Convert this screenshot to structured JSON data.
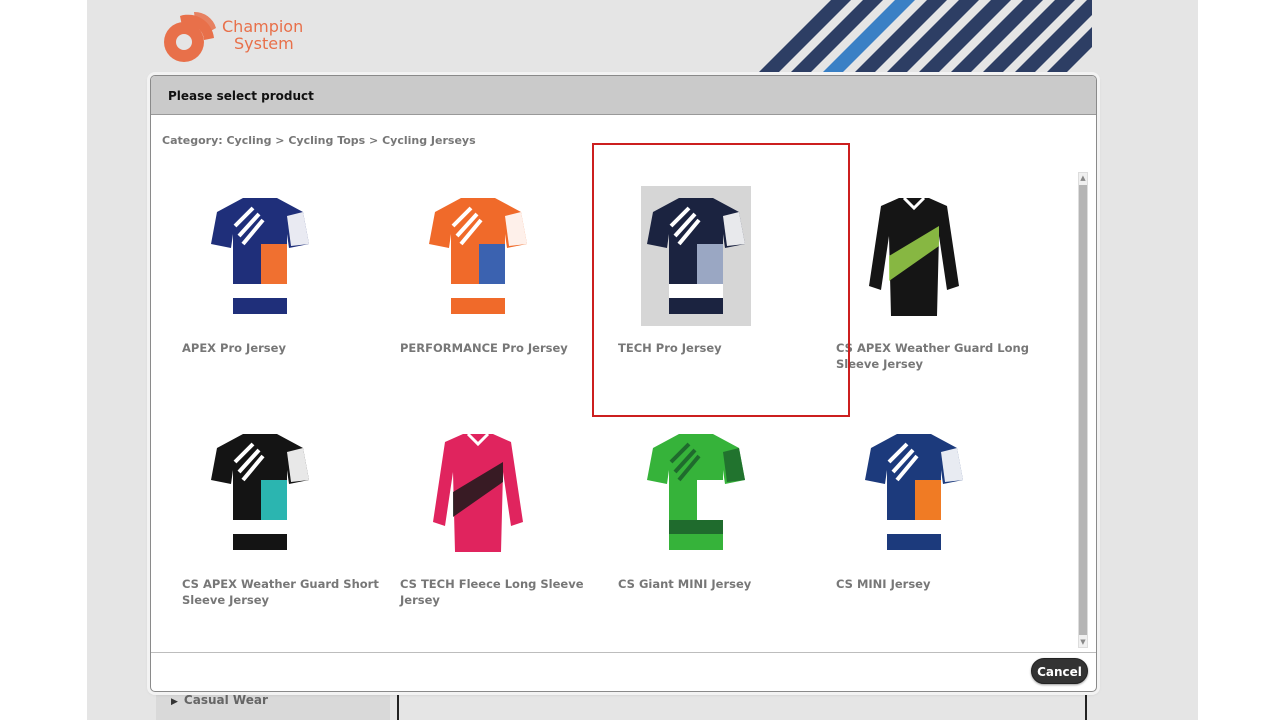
{
  "brand": {
    "line1": "Champion",
    "line2": "System",
    "color": "#e8704a"
  },
  "sidebar": {
    "visible_item": "Casual Wear"
  },
  "dialog": {
    "title": "Please select product",
    "breadcrumb": "Category: Cycling > Cycling Tops > Cycling Jerseys",
    "cancel_label": "Cancel",
    "products": [
      {
        "name": "APEX Pro Jersey",
        "icon": "short-sleeve-jersey-icon",
        "colors": [
          "#1f2f7a",
          "#f07030",
          "#ffffff"
        ]
      },
      {
        "name": "PERFORMANCE Pro Jersey",
        "icon": "short-sleeve-jersey-icon",
        "colors": [
          "#f06a2a",
          "#3b62b0",
          "#ffffff"
        ]
      },
      {
        "name": "TECH Pro Jersey",
        "icon": "short-sleeve-jersey-icon",
        "colors": [
          "#1b2340",
          "#9aa7c3",
          "#ffffff"
        ]
      },
      {
        "name": "CS APEX Weather Guard Long Sleeve Jersey",
        "icon": "long-sleeve-jersey-icon",
        "colors": [
          "#151515",
          "#9bd34a",
          "#ffffff"
        ]
      },
      {
        "name": "CS APEX Weather Guard Short Sleeve Jersey",
        "icon": "short-sleeve-jersey-icon",
        "colors": [
          "#141414",
          "#2bb5b0",
          "#ffffff"
        ]
      },
      {
        "name": "CS TECH Fleece Long Sleeve Jersey",
        "icon": "long-sleeve-jersey-icon",
        "colors": [
          "#e0245e",
          "#1a1a1a",
          "#ffffff"
        ]
      },
      {
        "name": "CS Giant MINI Jersey",
        "icon": "short-sleeve-jersey-icon",
        "colors": [
          "#36b33a",
          "#ffffff",
          "#1f6b2d"
        ]
      },
      {
        "name": "CS MINI Jersey",
        "icon": "short-sleeve-jersey-icon",
        "colors": [
          "#1c3a7c",
          "#f07b24",
          "#ffffff"
        ]
      }
    ],
    "selected_product": "TECH Pro Jersey",
    "highlight_color": "#cc1f1f"
  }
}
